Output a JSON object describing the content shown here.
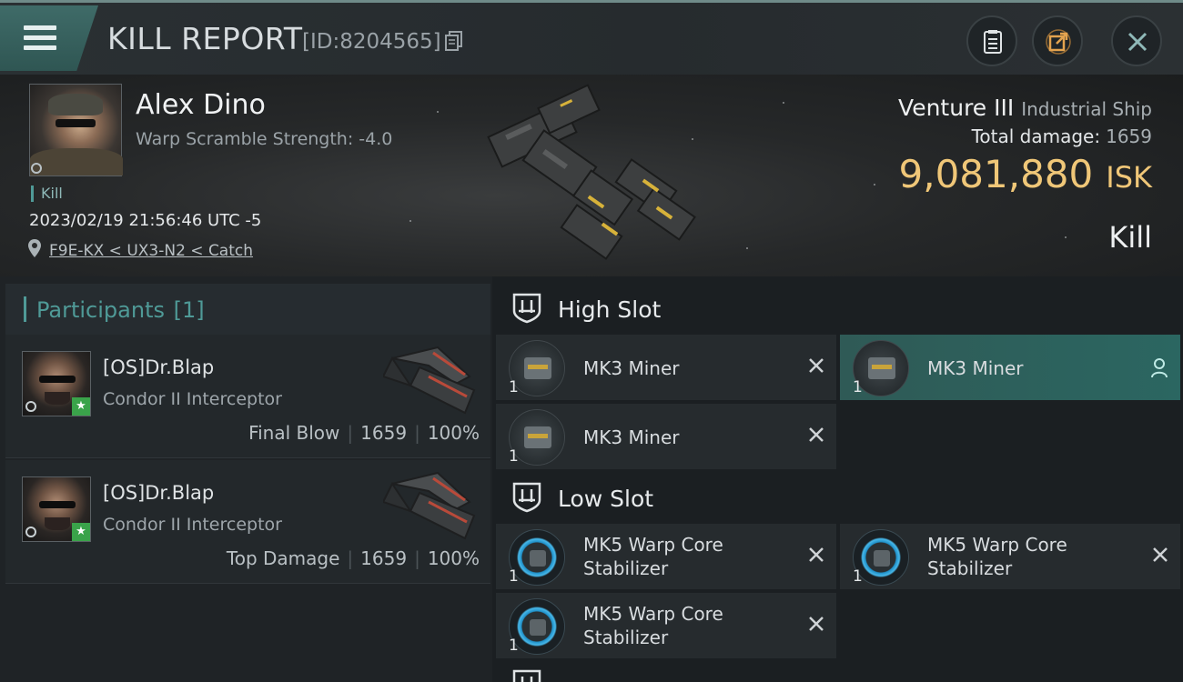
{
  "header": {
    "title": "KILL REPORT",
    "report_id": "[ID:8204565]"
  },
  "victim": {
    "name": "Alex Dino",
    "warp_scramble": "Warp Scramble Strength: -4.0",
    "tag": "Kill",
    "timestamp": "2023/02/19 21:56:46 UTC -5",
    "route": "F9E-KX < UX3-N2 < Catch",
    "ship_name": "Venture III",
    "ship_class": "Industrial Ship",
    "total_damage_label": "Total damage:",
    "total_damage": "1659",
    "isk_value": "9,081,880",
    "isk_unit": "ISK",
    "result": "Kill"
  },
  "participants": {
    "title": "Participants",
    "count": "[1]",
    "rows": [
      {
        "name": "[OS]Dr.Blap",
        "ship": "Condor II Interceptor",
        "role": "Final Blow",
        "damage": "1659",
        "percent": "100%"
      },
      {
        "name": "[OS]Dr.Blap",
        "ship": "Condor II Interceptor",
        "role": "Top Damage",
        "damage": "1659",
        "percent": "100%"
      }
    ]
  },
  "fitting": {
    "high_slot": {
      "label": "High Slot",
      "modules": [
        {
          "name": "MK3 Miner",
          "qty": "1"
        },
        {
          "name": "MK3 Miner",
          "qty": "1"
        },
        {
          "name": "MK3 Miner",
          "qty": "1"
        }
      ]
    },
    "low_slot": {
      "label": "Low Slot",
      "modules": [
        {
          "name_l1": "MK5 Warp Core",
          "name_l2": "Stabilizer",
          "qty": "1"
        },
        {
          "name_l1": "MK5 Warp Core",
          "name_l2": "Stabilizer",
          "qty": "1"
        },
        {
          "name_l1": "MK5 Warp Core",
          "name_l2": "Stabilizer",
          "qty": "1"
        }
      ]
    }
  },
  "colors": {
    "accent_teal": "#4f9a97",
    "isk_gold": "#f0c778",
    "fleet_green": "#3aa34a"
  },
  "icons": [
    "menu-icon",
    "copy-icon",
    "document-icon",
    "share-icon",
    "close-icon",
    "location-pin-icon",
    "shield-icon",
    "remove-x-icon",
    "person-icon"
  ]
}
